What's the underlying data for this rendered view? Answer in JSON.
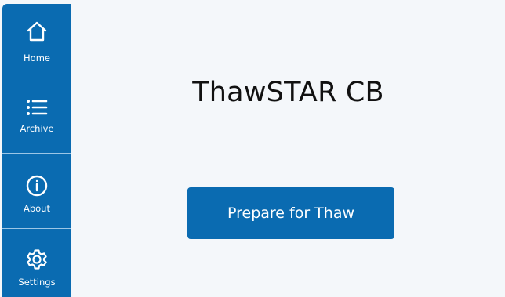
{
  "sidebar": {
    "items": [
      {
        "label": "Home",
        "icon": "home-icon"
      },
      {
        "label": "Archive",
        "icon": "list-icon"
      },
      {
        "label": "About",
        "icon": "info-icon"
      },
      {
        "label": "Settings",
        "icon": "gear-icon"
      }
    ]
  },
  "main": {
    "title": "ThawSTAR CB",
    "prepare_button_label": "Prepare for Thaw"
  },
  "colors": {
    "accent": "#0a6bb1",
    "background": "#f4f7fa",
    "title_text": "#111111",
    "button_text": "#ffffff"
  }
}
